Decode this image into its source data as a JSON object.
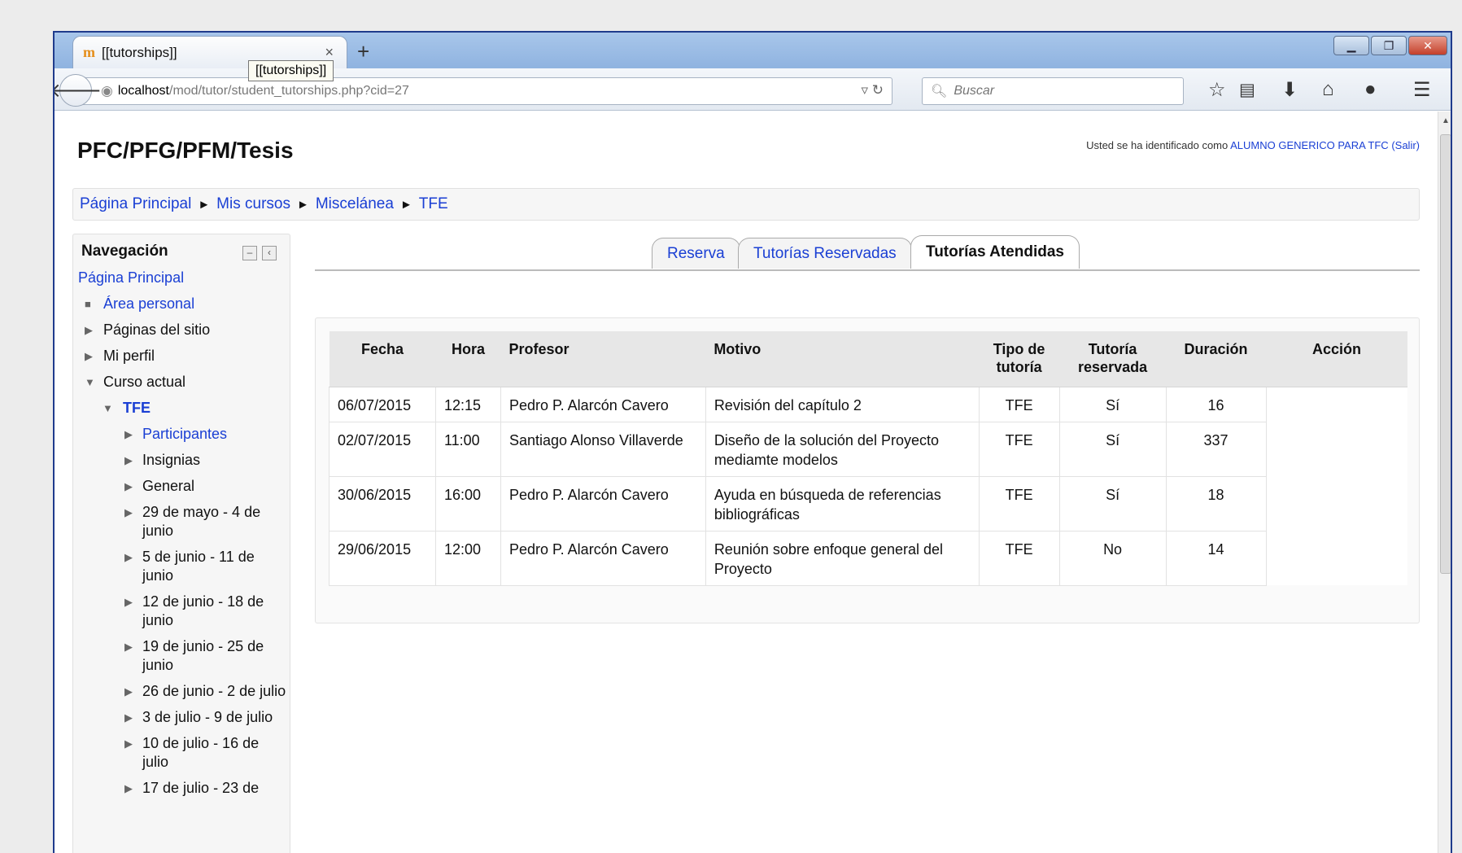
{
  "browser": {
    "tab_title": "[[tutorships]]",
    "tab_favicon": "m",
    "tab_close": "×",
    "new_tab": "+",
    "tooltip": "[[tutorships]]",
    "url_host": "localhost",
    "url_path": "/mod/tutor/student_tutorships.php?cid=27",
    "search_placeholder": "Buscar",
    "toolbar_icons": [
      "star-icon",
      "reading-list-icon",
      "download-icon",
      "home-icon",
      "chat-icon",
      "menu-icon"
    ]
  },
  "site": {
    "title": "PFC/PFG/PFM/Tesis",
    "login_prefix": "Usted se ha identificado como ",
    "login_user": "ALUMNO GENERICO PARA TFC",
    "login_logout": "(Salir)"
  },
  "breadcrumb": [
    "Página Principal",
    "Mis cursos",
    "Miscelánea",
    "TFE"
  ],
  "breadcrumb_sep": "►",
  "navigation": {
    "title": "Navegación",
    "items": [
      {
        "label": "Página Principal"
      },
      {
        "label": "Área personal"
      },
      {
        "label": "Páginas del sitio"
      },
      {
        "label": "Mi perfil"
      },
      {
        "label": "Curso actual"
      },
      {
        "label": "TFE"
      },
      {
        "label": "Participantes"
      },
      {
        "label": "Insignias"
      },
      {
        "label": "General"
      },
      {
        "label": "29 de mayo - 4 de junio"
      },
      {
        "label": "5 de junio - 11 de junio"
      },
      {
        "label": "12 de junio - 18 de junio"
      },
      {
        "label": "19 de junio - 25 de junio"
      },
      {
        "label": "26 de junio - 2 de julio"
      },
      {
        "label": "3 de julio - 9 de julio"
      },
      {
        "label": "10 de julio - 16 de julio"
      },
      {
        "label": "17 de julio - 23 de"
      }
    ]
  },
  "tabs": [
    {
      "label": "Reserva",
      "active": false
    },
    {
      "label": "Tutorías Reservadas",
      "active": false
    },
    {
      "label": "Tutorías Atendidas",
      "active": true
    }
  ],
  "table": {
    "headers": [
      "Fecha",
      "Hora",
      "Profesor",
      "Motivo",
      "Tipo de tutoría",
      "Tutoría reservada",
      "Duración",
      "Acción"
    ],
    "rows": [
      [
        "06/07/2015",
        "12:15",
        "Pedro P. Alarcón Cavero",
        "Revisión del capítulo 2",
        "TFE",
        "Sí",
        "16",
        ""
      ],
      [
        "02/07/2015",
        "11:00",
        "Santiago Alonso Villaverde",
        "Diseño de la solución del Proyecto mediamte modelos",
        "TFE",
        "Sí",
        "337",
        ""
      ],
      [
        "30/06/2015",
        "16:00",
        "Pedro P. Alarcón Cavero",
        "Ayuda en búsqueda de referencias bibliográficas",
        "TFE",
        "Sí",
        "18",
        ""
      ],
      [
        "29/06/2015",
        "12:00",
        "Pedro P. Alarcón Cavero",
        "Reunión sobre enfoque general del Proyecto",
        "TFE",
        "No",
        "14",
        ""
      ]
    ]
  }
}
